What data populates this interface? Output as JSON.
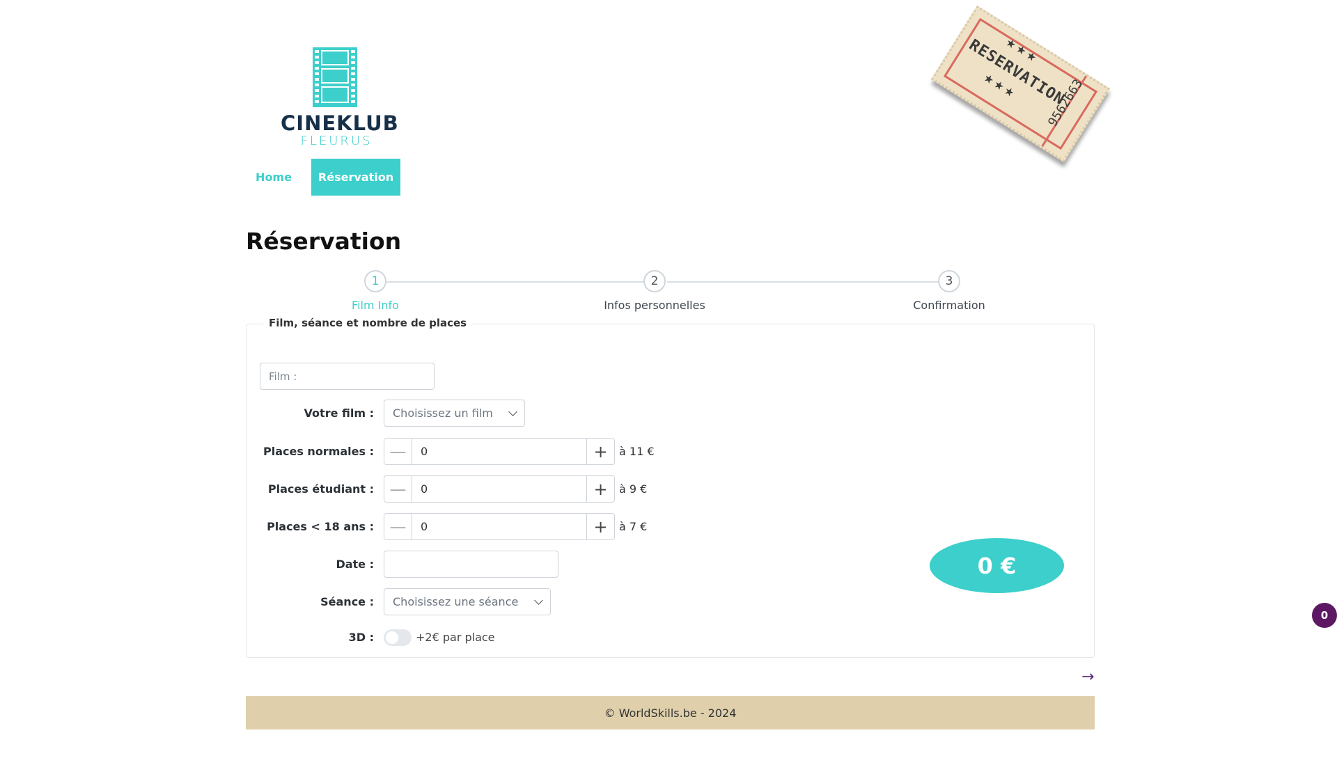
{
  "brand": {
    "name": "CINEKLUB",
    "subtitle": "FLEURUS"
  },
  "nav": {
    "items": [
      {
        "label": "Home"
      },
      {
        "label": "Réservation"
      }
    ],
    "active": "Réservation"
  },
  "ticket": {
    "label": "RESERVATION",
    "stars": "★★★",
    "number": "9562663"
  },
  "page_title": "Réservation",
  "stepper": {
    "steps": [
      {
        "number": "1",
        "label": "Film Info"
      },
      {
        "number": "2",
        "label": "Infos personnelles"
      },
      {
        "number": "3",
        "label": "Confirmation"
      }
    ],
    "current": "1"
  },
  "form": {
    "legend": "Film, séance et nombre de places",
    "film_search_placeholder": "Film :",
    "film": {
      "label": "Votre film :",
      "value": "Choisissez un film"
    },
    "tickets": [
      {
        "label": "Places normales :",
        "value": "0",
        "price": "à 11 €"
      },
      {
        "label": "Places étudiant :",
        "value": "0",
        "price": "à 9 €"
      },
      {
        "label": "Places < 18 ans :",
        "value": "0",
        "price": "à 7 €"
      }
    ],
    "date": {
      "label": "Date :",
      "value": ""
    },
    "seance": {
      "label": "Séance :",
      "value": "Choisissez une séance"
    },
    "three_d": {
      "label": "3D :",
      "note": "+2€ par place",
      "enabled": false
    },
    "total": "0 €"
  },
  "footer": {
    "text": "© WorldSkills.be - 2024"
  },
  "badge": {
    "count": "0"
  },
  "colors": {
    "accent": "#3ccfcb",
    "navy": "#163049",
    "footer_bg": "#dfd0ab",
    "badge_bg": "#5d1863"
  }
}
